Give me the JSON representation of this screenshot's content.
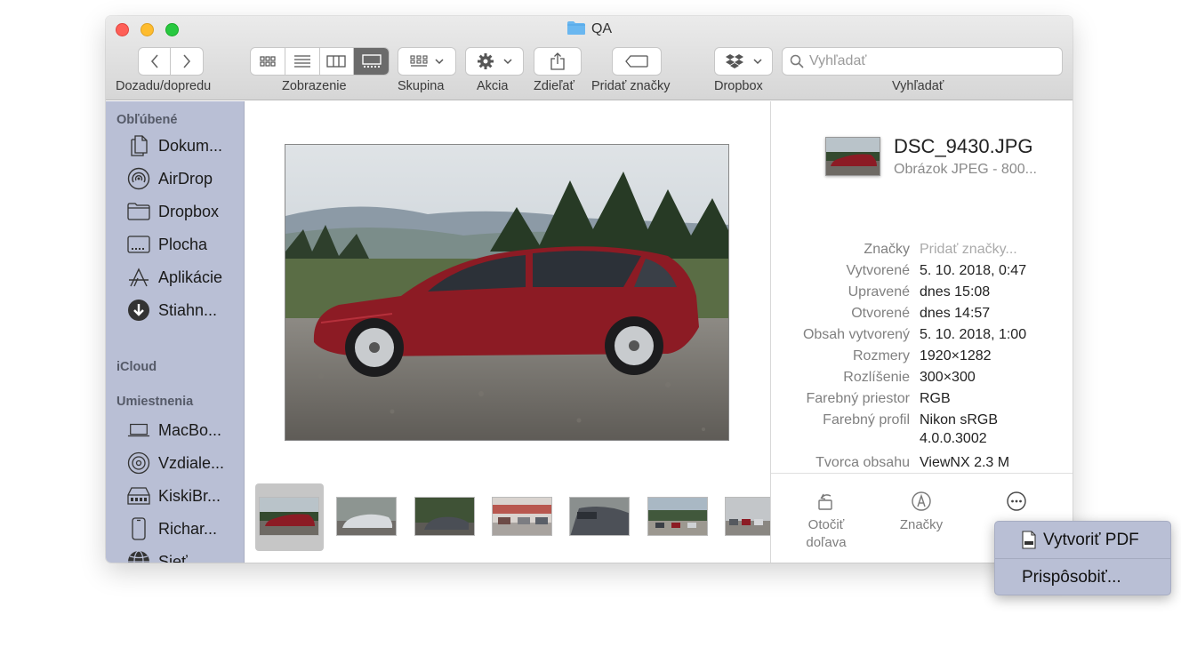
{
  "window": {
    "title": "QA"
  },
  "toolbar": {
    "nav_label": "Dozadu/dopredu",
    "view_label": "Zobrazenie",
    "group_label": "Skupina",
    "action_label": "Akcia",
    "share_label": "Zdieľať",
    "tags_label": "Pridať značky",
    "dropbox_label": "Dropbox",
    "search_label": "Vyhľadať",
    "search_placeholder": "Vyhľadať",
    "active_view": "gallery"
  },
  "sidebar": {
    "favorites_heading": "Obľúbené",
    "favorites": [
      {
        "label": "Dokum...",
        "icon": "document-icon"
      },
      {
        "label": "AirDrop",
        "icon": "airdrop-icon"
      },
      {
        "label": "Dropbox",
        "icon": "folder-icon"
      },
      {
        "label": "Plocha",
        "icon": "desktop-icon"
      },
      {
        "label": "Aplikácie",
        "icon": "applications-icon"
      },
      {
        "label": "Stiahn...",
        "icon": "download-icon"
      }
    ],
    "icloud_heading": "iCloud",
    "locations_heading": "Umiestnenia",
    "locations": [
      {
        "label": "MacBo...",
        "icon": "laptop-icon"
      },
      {
        "label": "Vzdiale...",
        "icon": "disc-icon"
      },
      {
        "label": "KiskiBr...",
        "icon": "drive-icon"
      },
      {
        "label": "Richar...",
        "icon": "phone-icon"
      },
      {
        "label": "Sieť",
        "icon": "network-icon"
      }
    ],
    "background": "#b9bfd5"
  },
  "preview": {
    "thumbnail_count": 7,
    "selected_index": 0
  },
  "info": {
    "file_name": "DSC_9430.JPG",
    "file_kind": "Obrázok JPEG - 800...",
    "meta": [
      {
        "key": "Značky",
        "value": "Pridať značky..."
      },
      {
        "key": "Vytvorené",
        "value": "5. 10. 2018, 0:47"
      },
      {
        "key": "Upravené",
        "value": "dnes 15:08"
      },
      {
        "key": "Otvorené",
        "value": "dnes 14:57"
      },
      {
        "key": "Obsah vytvorený",
        "value": "5. 10. 2018, 1:00"
      },
      {
        "key": "Rozmery",
        "value": "1920×1282"
      },
      {
        "key": "Rozlíšenie",
        "value": "300×300"
      },
      {
        "key": "Farebný priestor",
        "value": "RGB"
      },
      {
        "key": "Farebný profil",
        "value": "Nikon sRGB",
        "value2": "4.0.0.3002"
      },
      {
        "key": "Tvorca obsahu",
        "value": "ViewNX 2.3 M"
      }
    ],
    "quick_actions": {
      "rotate_line1": "Otočiť",
      "rotate_line2": "doľava",
      "markup": "Značky"
    }
  },
  "popup": {
    "create_pdf": "Vytvoriť PDF",
    "customize": "Prispôsobiť..."
  },
  "colors": {
    "accent_folder": "#6ab7f0",
    "car_red": "#8c1b24",
    "active_segment": "#6b6b6b"
  }
}
